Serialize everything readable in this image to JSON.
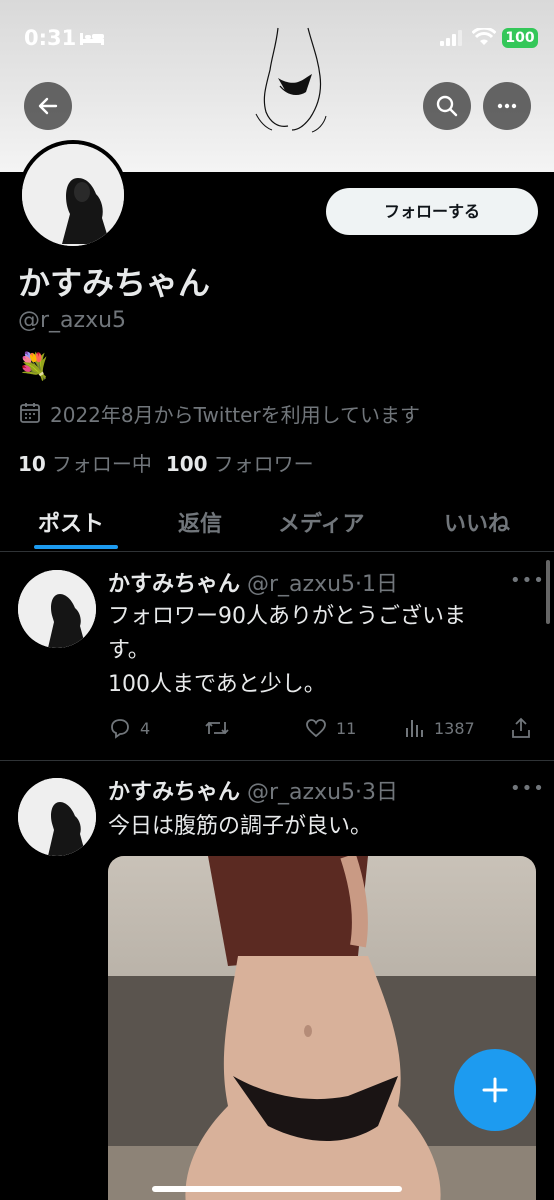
{
  "status_bar": {
    "time": "0:31",
    "battery": "100"
  },
  "header": {
    "back_icon": "arrow-left-icon",
    "search_icon": "search-icon",
    "more_icon": "more-horizontal-icon"
  },
  "profile": {
    "follow_label": "フォローする",
    "display_name": "かすみちゃん",
    "handle": "@r_azxu5",
    "bio": "💐",
    "joined": "2022年8月からTwitterを利用しています",
    "following_count": "10",
    "following_label": "フォロー中",
    "followers_count": "100",
    "followers_label": "フォロワー"
  },
  "tabs": [
    {
      "label": "ポスト",
      "active": true
    },
    {
      "label": "返信"
    },
    {
      "label": "メディア"
    },
    {
      "label": "いいね"
    }
  ],
  "tweets": [
    {
      "name": "かすみちゃん",
      "meta": "@r_azxu5·1日",
      "lines": [
        "フォロワー90人ありがとうございま",
        "す。",
        "100人まであと少し。"
      ],
      "replies": "4",
      "likes": "11",
      "views": "1387"
    },
    {
      "name": "かすみちゃん",
      "meta": "@r_azxu5·3日",
      "lines": [
        "今日は腹筋の調子が良い。"
      ]
    }
  ],
  "colors": {
    "accent": "#1d9bf0",
    "text": "#e7e9ea",
    "muted": "#71767b",
    "bg": "#000000"
  }
}
